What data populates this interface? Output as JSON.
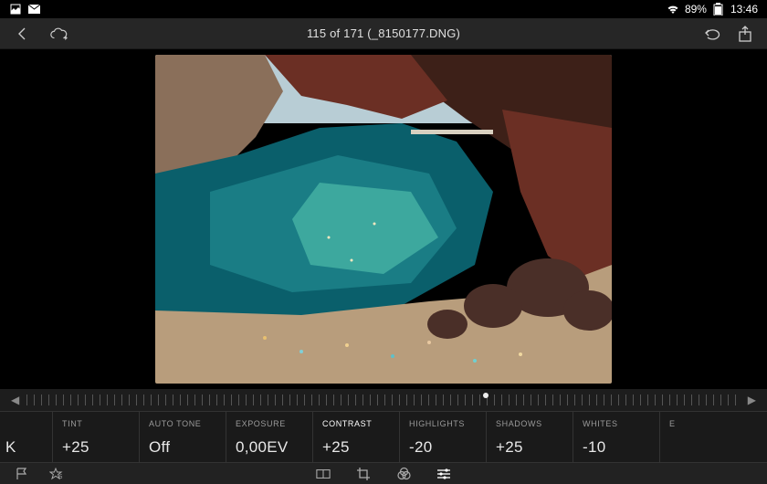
{
  "status_bar": {
    "battery_text": "89%",
    "time": "13:46"
  },
  "header": {
    "title": "115 of 171 (_8150177.DNG)"
  },
  "adjustments": [
    {
      "label": "",
      "value": "K",
      "partial": "left"
    },
    {
      "label": "TINT",
      "value": "+25"
    },
    {
      "label": "AUTO TONE",
      "value": "Off"
    },
    {
      "label": "EXPOSURE",
      "value": "0,00EV"
    },
    {
      "label": "CONTRAST",
      "value": "+25",
      "selected": true
    },
    {
      "label": "HIGHLIGHTS",
      "value": "-20"
    },
    {
      "label": "SHADOWS",
      "value": "+25"
    },
    {
      "label": "WHITES",
      "value": "-10"
    },
    {
      "label": "E",
      "value": "",
      "partial": "right"
    }
  ]
}
